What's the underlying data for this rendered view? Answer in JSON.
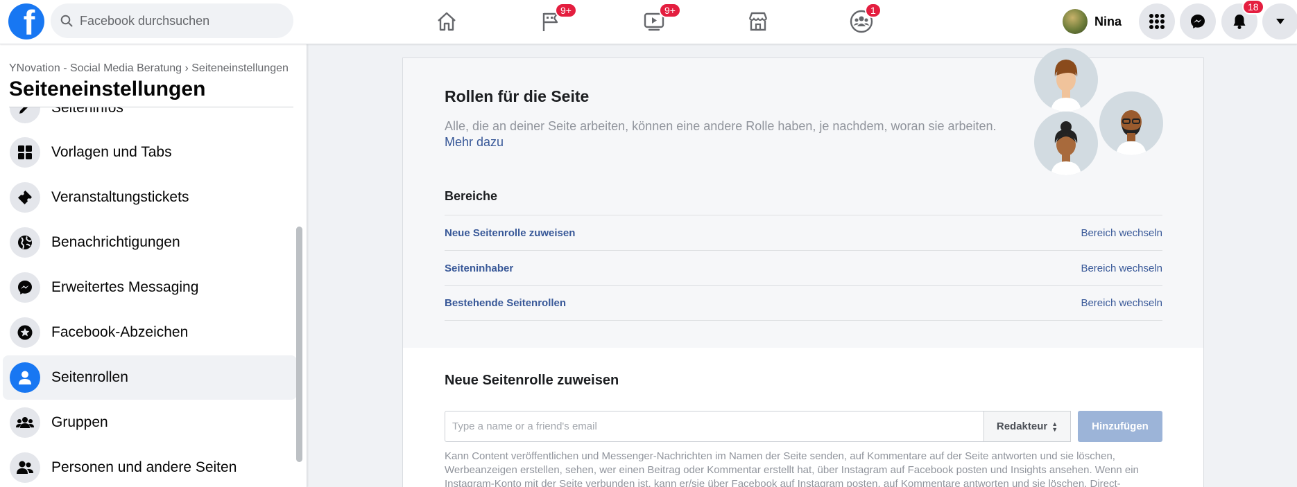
{
  "topbar": {
    "logo": "f",
    "search_placeholder": "Facebook durchsuchen",
    "nav": [
      {
        "icon": "home-icon",
        "badge": ""
      },
      {
        "icon": "flag-icon",
        "badge": "9+"
      },
      {
        "icon": "watch-icon",
        "badge": "9+"
      },
      {
        "icon": "marketplace-icon",
        "badge": ""
      },
      {
        "icon": "groups-icon",
        "badge": "1"
      }
    ],
    "profile_name": "Nina",
    "notifications_badge": "18"
  },
  "sidebar": {
    "breadcrumb": "YNovation - Social Media Beratung › Seiteneinstellungen",
    "title": "Seiteneinstellungen",
    "items": [
      {
        "label": "Seiteninfos",
        "icon": "pencil-icon"
      },
      {
        "label": "Vorlagen und Tabs",
        "icon": "grid-icon"
      },
      {
        "label": "Veranstaltungstickets",
        "icon": "ticket-icon"
      },
      {
        "label": "Benachrichtigungen",
        "icon": "globe-icon"
      },
      {
        "label": "Erweitertes Messaging",
        "icon": "messenger-icon"
      },
      {
        "label": "Facebook-Abzeichen",
        "icon": "star-badge-icon"
      },
      {
        "label": "Seitenrollen",
        "icon": "person-icon",
        "active": true
      },
      {
        "label": "Gruppen",
        "icon": "groups-icon"
      },
      {
        "label": "Personen und andere Seiten",
        "icon": "people-icon"
      }
    ]
  },
  "roles": {
    "title": "Rollen für die Seite",
    "description": "Alle, die an deiner Seite arbeiten, können eine andere Rolle haben, je nachdem, woran sie arbeiten.",
    "learn_more": "Mehr dazu",
    "areas_title": "Bereiche",
    "areas": [
      {
        "name": "Neue Seitenrolle zuweisen",
        "action": "Bereich wechseln"
      },
      {
        "name": "Seiteninhaber",
        "action": "Bereich wechseln"
      },
      {
        "name": "Bestehende Seitenrollen",
        "action": "Bereich wechseln"
      }
    ]
  },
  "assign": {
    "title": "Neue Seitenrolle zuweisen",
    "input_placeholder": "Type a name or a friend's email",
    "role_value": "Redakteur",
    "add_label": "Hinzufügen",
    "help_text": "Kann Content veröffentlichen und Messenger-Nachrichten im Namen der Seite senden, auf Kommentare auf der Seite antworten und sie löschen, Werbeanzeigen erstellen, sehen, wer einen Beitrag oder Kommentar erstellt hat, über Instagram auf Facebook posten und Insights ansehen. Wenn ein Instagram-Konto mit der Seite verbunden ist, kann er/sie über Facebook auf Instagram posten, auf Kommentare antworten und sie löschen. Direct-"
  },
  "colors": {
    "brand": "#1877f2",
    "link": "#385898",
    "badge": "#e41e3f"
  }
}
